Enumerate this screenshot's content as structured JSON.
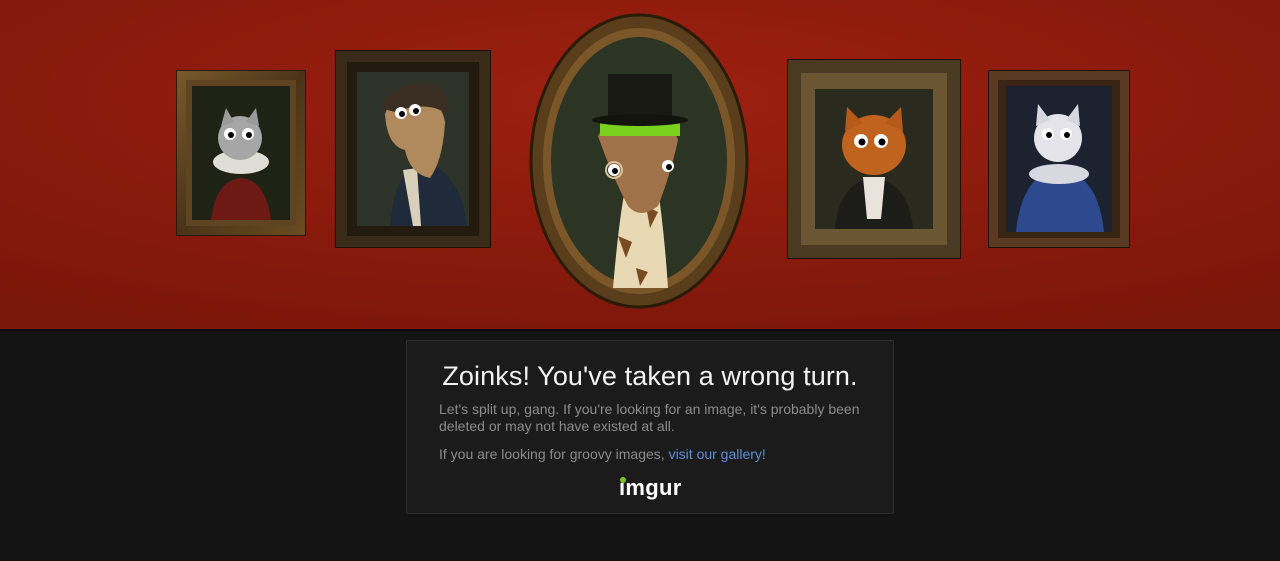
{
  "banner": {
    "background_color": "#8f1a0c",
    "portraits": [
      {
        "subject": "grey-cat-ruff-collar-portrait"
      },
      {
        "subject": "horse-bicorne-hat-portrait"
      },
      {
        "subject": "giraffe-top-hat-monocle-portrait"
      },
      {
        "subject": "orange-cat-cravat-portrait"
      },
      {
        "subject": "white-cat-blue-gown-portrait"
      }
    ]
  },
  "error": {
    "title": "Zoinks! You've taken a wrong turn.",
    "message": "Let's split up, gang. If you're looking for an image, it's probably been deleted or may not have existed at all.",
    "gallery_prefix": "If you are looking for groovy images, ",
    "gallery_link": "visit our gallery!",
    "logo": "imgur",
    "link_color": "#5a8fd9",
    "logo_dot_color": "#85bf25"
  }
}
